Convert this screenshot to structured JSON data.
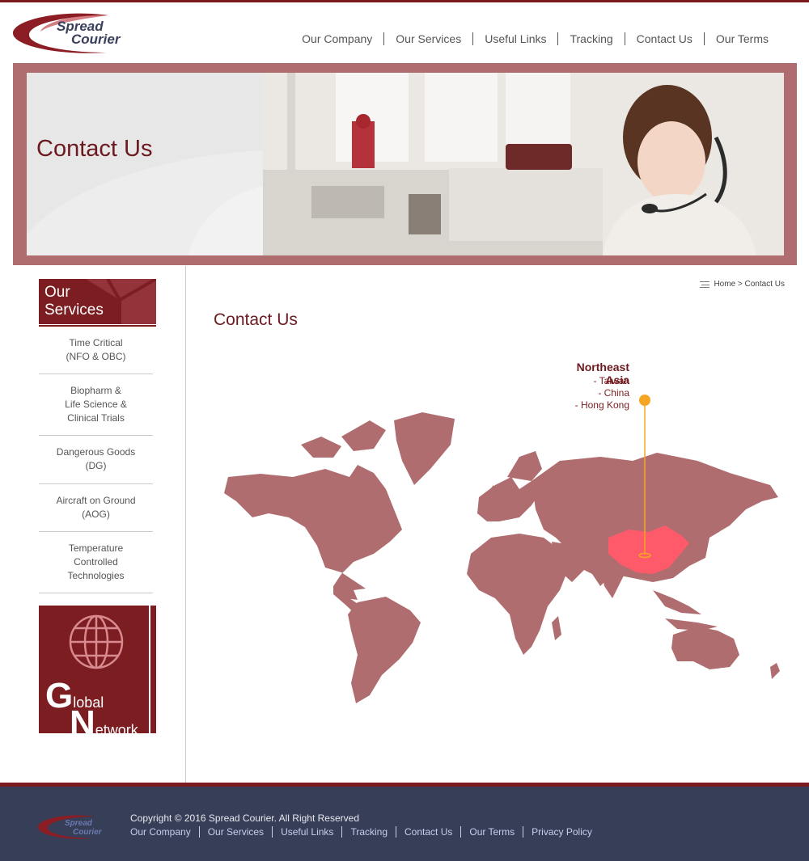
{
  "brand": {
    "logo_line1": "Spread",
    "logo_line2": "Courier",
    "colors": {
      "primary": "#7c1d22",
      "banner": "#b06d70",
      "footer": "#373e58",
      "map": "#b06d70",
      "highlight": "#ff5a6a",
      "pin": "#f5a623"
    }
  },
  "nav": {
    "items": [
      "Our Company",
      "Our Services",
      "Useful Links",
      "Tracking",
      "Contact Us",
      "Our Terms"
    ]
  },
  "banner": {
    "title": "Contact Us"
  },
  "sidebar": {
    "services_title": "Our Services",
    "services": [
      "Time Critical\n(NFO & OBC)",
      "Biopharm &\nLife Science &\nClinical Trials",
      "Dangerous Goods\n(DG)",
      "Aircraft on Ground\n(AOG)",
      "Temperature\nControlled\nTechnologies"
    ],
    "global_network": {
      "big1": "G",
      "word1": "lobal",
      "big2": "N",
      "word2": "etwork"
    }
  },
  "breadcrumb": {
    "text": "Home > Contact Us"
  },
  "main": {
    "title": "Contact Us",
    "region": {
      "name": "Northeast Asia",
      "countries": [
        "- Taiwan",
        "- China",
        "- Hong Kong"
      ]
    }
  },
  "footer": {
    "copyright": "Copyright © 2016 Spread Courier. All Right Reserved",
    "links": [
      "Our Company",
      "Our Services",
      "Useful Links",
      "Tracking",
      "Contact Us",
      "Our Terms",
      "Privacy Policy"
    ]
  }
}
